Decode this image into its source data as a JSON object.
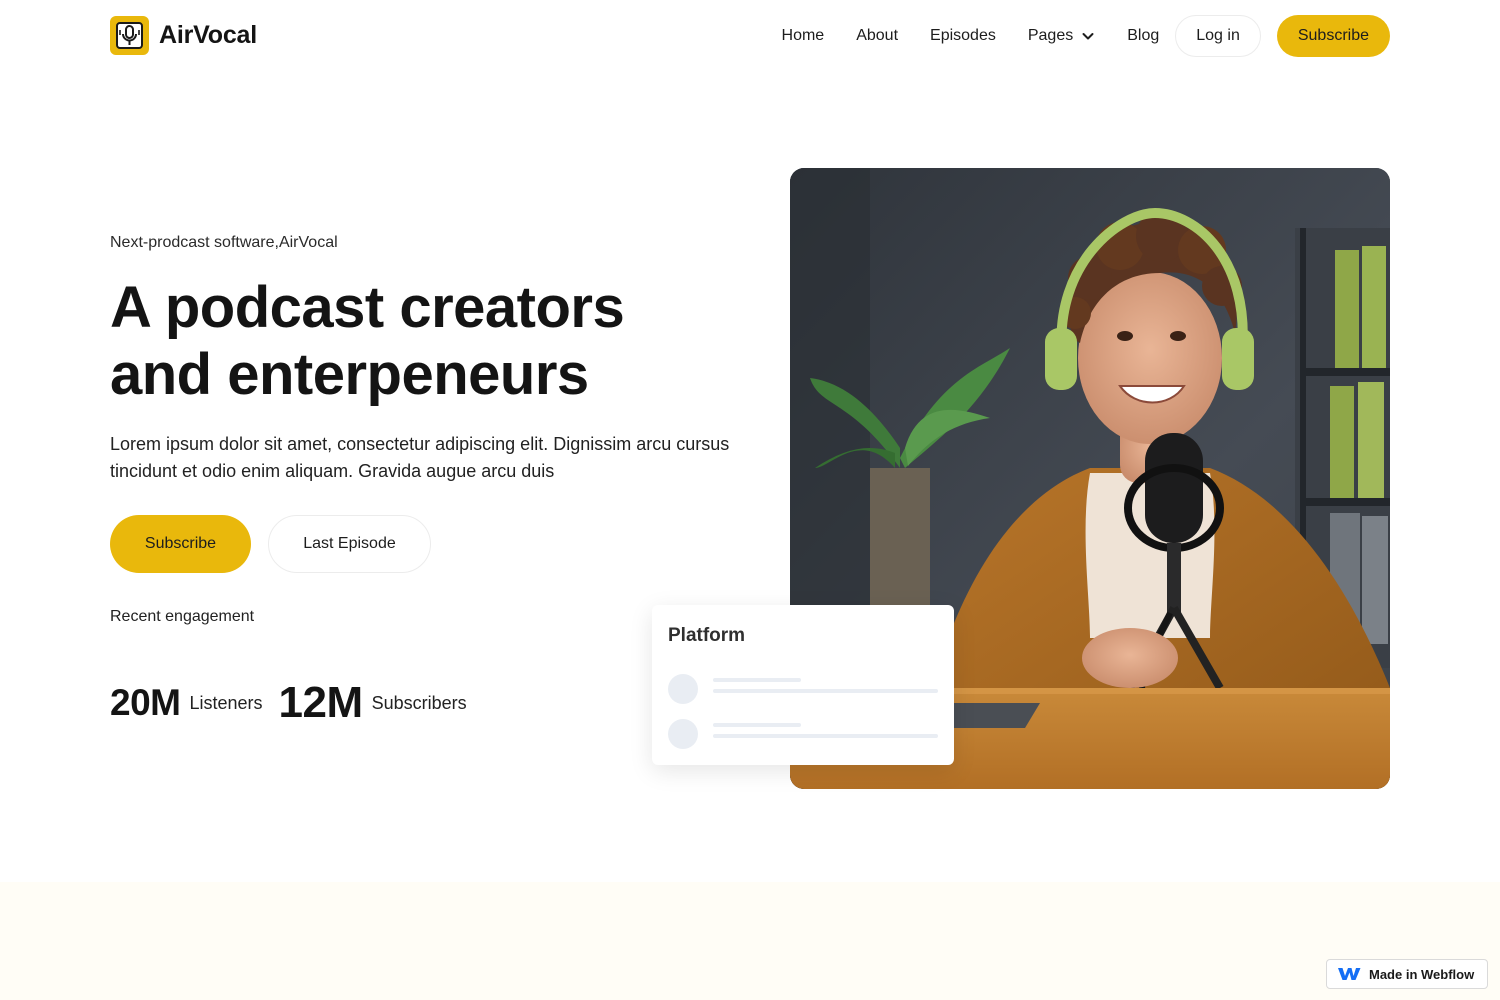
{
  "brand": {
    "name": "AirVocal",
    "logo_icon": "microphone-icon",
    "accent": "#e9b80c"
  },
  "nav": {
    "items": [
      {
        "label": "Home"
      },
      {
        "label": "About"
      },
      {
        "label": "Episodes"
      },
      {
        "label": "Pages",
        "icon": "chevron-down-icon"
      },
      {
        "label": "Blog"
      }
    ],
    "login_label": "Log in",
    "subscribe_label": "Subscribe"
  },
  "hero": {
    "eyebrow": "Next-prodcast software,AirVocal",
    "title_line1": "A podcast creators",
    "title_line2": "and enterpeneurs",
    "description": "Lorem ipsum dolor sit amet, consectetur adipiscing elit. Dignissim arcu cursus tincidunt et odio enim aliquam. Gravida augue arcu duis",
    "cta_primary": "Subscribe",
    "cta_secondary": "Last Episode",
    "engagement_label": "Recent engagement",
    "stats": [
      {
        "value": "20M",
        "label": "Listeners"
      },
      {
        "value": "12M",
        "label": "Subscribers"
      }
    ]
  },
  "platform_card": {
    "title": "Platform"
  },
  "footer_badge": {
    "label": "Made in Webflow",
    "icon": "webflow-icon"
  }
}
